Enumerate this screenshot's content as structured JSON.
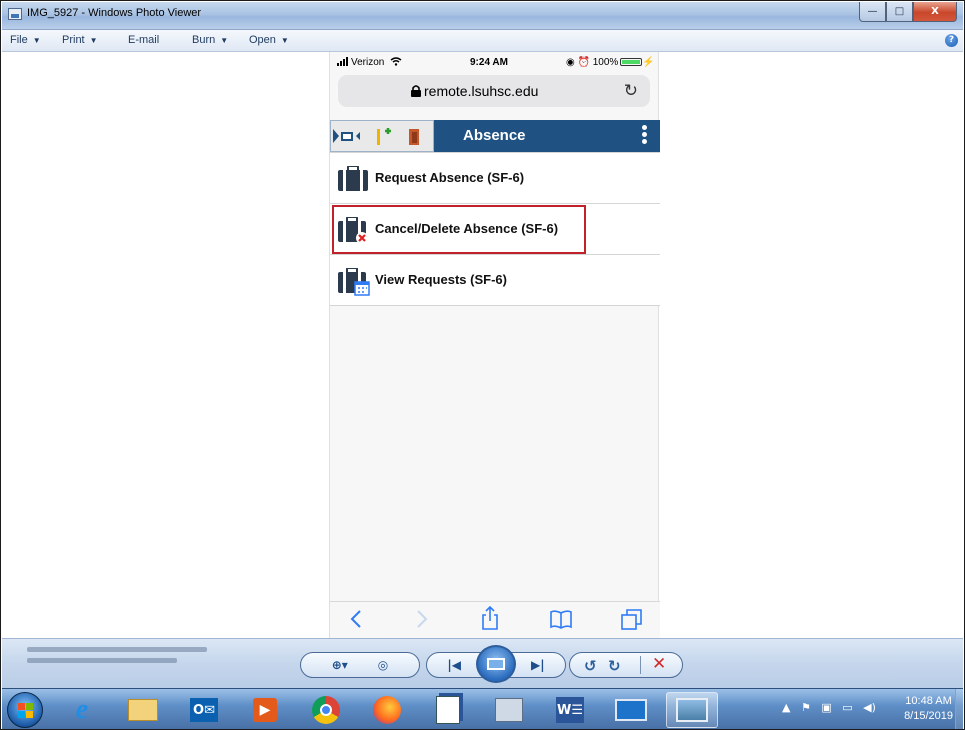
{
  "window": {
    "title": "IMG_5927 - Windows Photo Viewer",
    "controls": {
      "minimize": "—",
      "maximize": "□",
      "close": "X"
    }
  },
  "menubar": {
    "items": [
      {
        "label": "File",
        "caret": "▼"
      },
      {
        "label": "Print",
        "caret": "▼"
      },
      {
        "label": "E-mail",
        "caret": ""
      },
      {
        "label": "Burn",
        "caret": "▼"
      },
      {
        "label": "Open",
        "caret": "▼"
      }
    ],
    "help": "?"
  },
  "phone": {
    "status": {
      "carrier": "Verizon",
      "time": "9:24 AM",
      "battery": "100%"
    },
    "url": "remote.lsuhsc.edu",
    "app_title": "Absence",
    "menu_items": [
      {
        "label": "Request Absence (SF-6)",
        "icon": "briefcase-icon"
      },
      {
        "label": "Cancel/Delete Absence (SF-6)",
        "icon": "briefcase-cancel-icon"
      },
      {
        "label": "View Requests (SF-6)",
        "icon": "briefcase-calendar-icon"
      }
    ],
    "highlighted_item": "Cancel/Delete Absence (SF-6)"
  },
  "viewer_controls": {
    "zoom": "zoom-icon",
    "fit": "actual-size-icon",
    "previous": "previous-icon",
    "slideshow": "slideshow-icon",
    "next": "next-icon",
    "rotate_ccw": "rotate-counterclockwise-icon",
    "rotate_cw": "rotate-clockwise-icon",
    "delete": "delete-icon"
  },
  "taskbar": {
    "apps": [
      "internet-explorer-icon",
      "file-explorer-icon",
      "outlook-icon",
      "office-icon",
      "chrome-icon",
      "firefox-icon",
      "word-doc-icon",
      "library-icon",
      "word-icon",
      "remote-desktop-icon",
      "photo-viewer-icon"
    ],
    "clock": {
      "time": "10:48 AM",
      "date": "8/15/2019"
    }
  }
}
